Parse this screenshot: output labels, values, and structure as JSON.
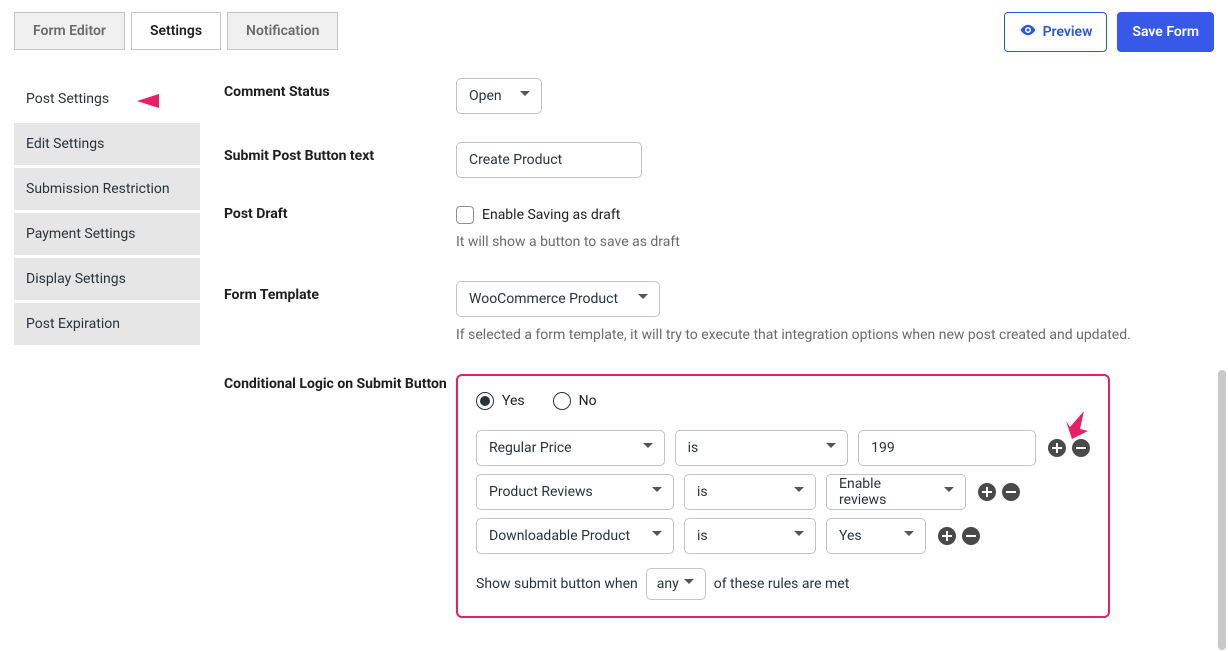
{
  "tabs": {
    "form_editor": "Form Editor",
    "settings": "Settings",
    "notification": "Notification"
  },
  "actions": {
    "preview": "Preview",
    "save_form": "Save Form"
  },
  "sidebar": {
    "items": [
      "Post Settings",
      "Edit Settings",
      "Submission Restriction",
      "Payment Settings",
      "Display Settings",
      "Post Expiration"
    ]
  },
  "fields": {
    "comment_status": {
      "label": "Comment Status",
      "value": "Open"
    },
    "submit_btn_text": {
      "label": "Submit Post Button text",
      "value": "Create Product"
    },
    "post_draft": {
      "label": "Post Draft",
      "checkbox_label": "Enable Saving as draft",
      "hint": "It will show a button to save as draft"
    },
    "form_template": {
      "label": "Form Template",
      "value": "WooCommerce Product",
      "hint": "If selected a form template, it will try to execute that integration options when new post created and updated."
    }
  },
  "conditional": {
    "label": "Conditional Logic on Submit Button",
    "yes": "Yes",
    "no": "No",
    "rules": [
      {
        "field": "Regular Price",
        "op": "is",
        "value": "199",
        "valueType": "input",
        "fieldW": 198,
        "opW": 182,
        "valW": 188
      },
      {
        "field": "Product Reviews",
        "op": "is",
        "value": "Enable reviews",
        "valueType": "select",
        "fieldW": 198,
        "opW": 132,
        "valW": 140
      },
      {
        "field": "Downloadable Product",
        "op": "is",
        "value": "Yes",
        "valueType": "select",
        "fieldW": 198,
        "opW": 132,
        "valW": 100
      }
    ],
    "match_prefix": "Show submit button when",
    "match_mode": "any",
    "match_suffix": "of these rules are met"
  }
}
